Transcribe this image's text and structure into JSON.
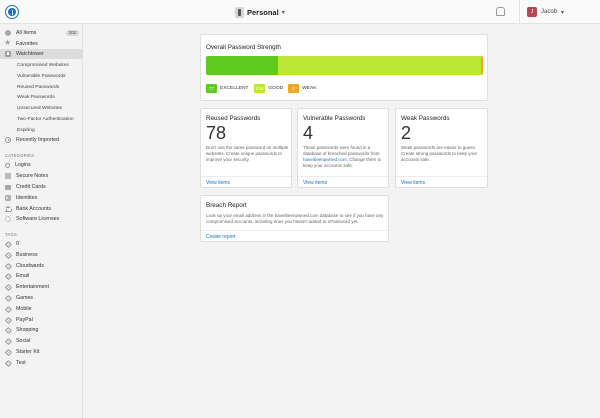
{
  "topbar": {
    "vault_name": "Personal",
    "user_initial": "J",
    "user_name": "Jacob"
  },
  "sidebar": {
    "all_items_label": "All Items",
    "all_items_count": "302",
    "favorites_label": "Favorites",
    "watchtower_label": "Watchtower",
    "watchtower_sub": [
      "Compromised Websites",
      "Vulnerable Passwords",
      "Reused Passwords",
      "Weak Passwords",
      "Unsecured Websites",
      "Two-Factor Authentication",
      "Expiring"
    ],
    "recently_imported_label": "Recently Imported",
    "categories_header": "CATEGORIES",
    "categories": [
      "Logins",
      "Secure Notes",
      "Credit Cards",
      "Identities",
      "Bank Accounts",
      "Software Licenses"
    ],
    "tags_header": "TAGS",
    "tags": [
      "0",
      "Business",
      "Cloudwards",
      "Email",
      "Entertainment",
      "Games",
      "Mobile",
      "PayPal",
      "Shopping",
      "Social",
      "Starter Kit",
      "Test"
    ]
  },
  "strength": {
    "title": "Overall Password Strength",
    "excellent_count": "77",
    "excellent_label": "EXCELLENT",
    "good_count": "219",
    "good_label": "GOOD",
    "weak_count": "2",
    "weak_label": "WEAK",
    "colors": {
      "excellent": "#5dcc1e",
      "good": "#bce835",
      "weak": "#f5a623"
    }
  },
  "reused": {
    "title": "Reused Passwords",
    "count": "78",
    "desc": "Don't use the same password on multiple websites. Create unique passwords to improve your security.",
    "link": "View items"
  },
  "vulnerable": {
    "title": "Vulnerable Passwords",
    "count": "4",
    "desc_pre": "These passwords were found in a database of breached passwords from ",
    "desc_link": "haveibeenpwned.com",
    "desc_post": ". Change them to keep your accounts safe.",
    "link": "View items"
  },
  "weak": {
    "title": "Weak Passwords",
    "count": "2",
    "desc": "Weak passwords are easier to guess. Create strong passwords to keep your accounts safe.",
    "link": "View items"
  },
  "breach": {
    "title": "Breach Report",
    "desc": "Look up your email address in the haveibeenpwned.com database to see if you have any compromised accounts, including ones you haven't added to 1Password yet.",
    "link": "Create report"
  }
}
